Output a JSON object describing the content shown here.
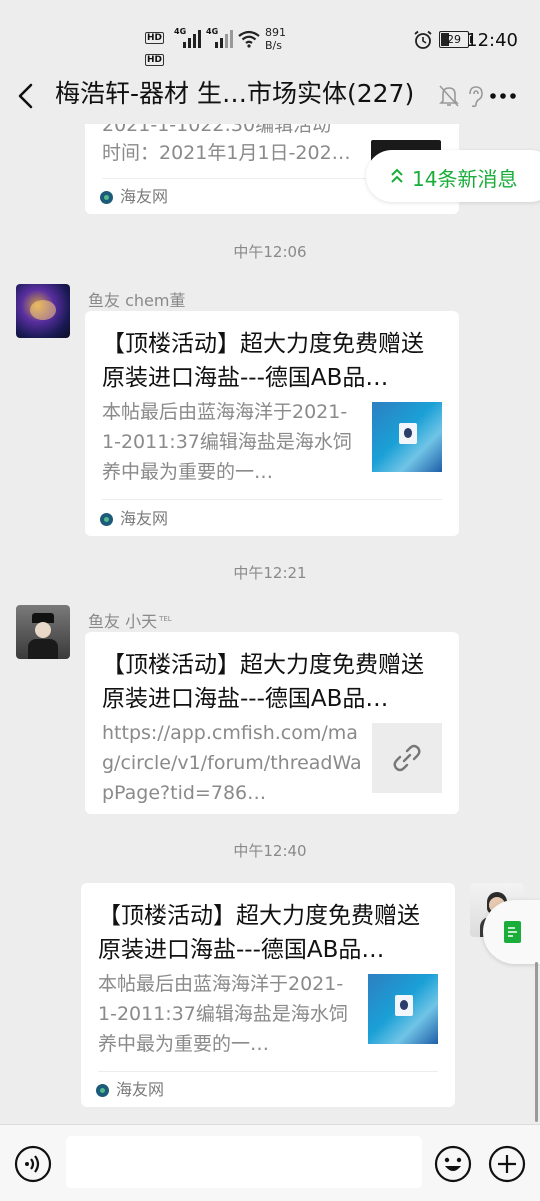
{
  "status_bar": {
    "hd1": "HD",
    "hd2": "HD",
    "net1": "4G",
    "net2": "4G",
    "speed_value": "891",
    "speed_unit": "B/s",
    "battery": "29",
    "time": "12:40"
  },
  "chat": {
    "title": "梅浩轩-器材 生…市场实体(227)",
    "new_messages": "14条新消息"
  },
  "messages": [
    {
      "partial_line": "2021-1-1022:30编辑活动",
      "desc": "时间：2021年1月1日-202…",
      "source": "海友网"
    },
    {
      "time": "中午12:06",
      "sender": "鱼友 chem董",
      "title": "【顶楼活动】超大力度免费赠送原装进口海盐---德国AB品…",
      "desc": "本帖最后由蓝海海洋于2021-1-2011:37编辑海盐是海水饲养中最为重要的一…",
      "source": "海友网"
    },
    {
      "time": "中午12:21",
      "sender": "鱼友 小天",
      "sender_badge": "TEL",
      "title": "【顶楼活动】超大力度免费赠送原装进口海盐---德国AB品…",
      "desc": "https://app.cmfish.com/mag/circle/v1/forum/threadWapPage?tid=786…"
    },
    {
      "time": "中午12:40",
      "title": "【顶楼活动】超大力度免费赠送原装进口海盐---德国AB品…",
      "desc": "本帖最后由蓝海海洋于2021-1-2011:37编辑海盐是海水饲养中最为重要的一…",
      "source": "海友网"
    }
  ],
  "colors": {
    "background": "#ededed",
    "accent_green": "#1aad3a",
    "card": "#ffffff",
    "muted_text": "#8a8a8a"
  },
  "icons": [
    "back-arrow-icon",
    "mute-bell-icon",
    "ear-icon",
    "more-icon",
    "voice-icon",
    "emoji-icon",
    "plus-icon",
    "link-icon",
    "double-chevron-up-icon",
    "note-icon",
    "alarm-icon",
    "wifi-icon",
    "signal-icon",
    "battery-icon"
  ]
}
